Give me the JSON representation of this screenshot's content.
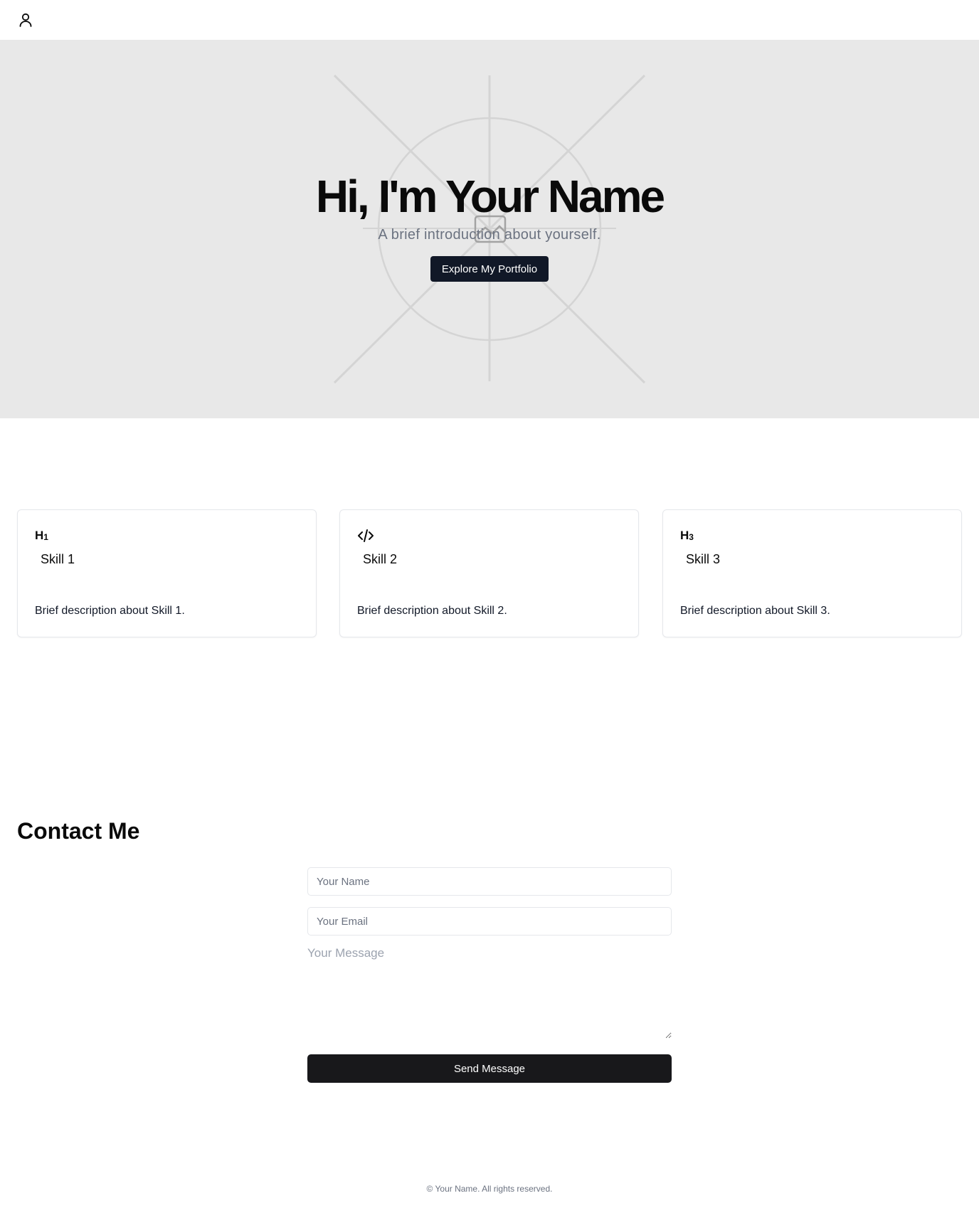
{
  "header": {
    "user_icon": "user-icon"
  },
  "hero": {
    "title": "Hi, I'm Your Name",
    "subtitle": "A brief introduction about yourself.",
    "button_label": "Explore My Portfolio",
    "background_image_icon": "image-placeholder-icon"
  },
  "skills": [
    {
      "icon": "H1",
      "icon_name": "heading-1-icon",
      "title": "Skill 1",
      "description": "Brief description about Skill 1."
    },
    {
      "icon": "</>",
      "icon_name": "code-icon",
      "title": "Skill 2",
      "description": "Brief description about Skill 2."
    },
    {
      "icon": "H3",
      "icon_name": "heading-3-icon",
      "title": "Skill 3",
      "description": "Brief description about Skill 3."
    }
  ],
  "contact": {
    "title": "Contact Me",
    "name_placeholder": "Your Name",
    "email_placeholder": "Your Email",
    "message_placeholder": "Your Message",
    "send_label": "Send Message"
  },
  "footer": {
    "text": "© Your Name. All rights reserved."
  },
  "colors": {
    "hero_bg": "#e8e8e8",
    "primary_button": "#111827",
    "send_button": "#18181b",
    "muted_text": "#6b7280"
  }
}
